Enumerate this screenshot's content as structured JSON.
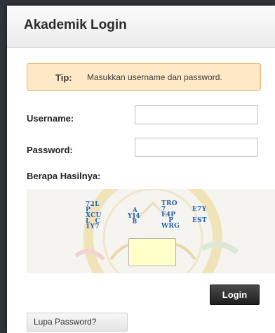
{
  "dialog": {
    "title": "Akademik Login"
  },
  "tip": {
    "label": "Tip:",
    "text": "Masukkan username dan password."
  },
  "form": {
    "username_label": "Username:",
    "username_value": "",
    "password_label": "Password:",
    "password_value": "",
    "captcha_label": "Berapa Hasilnya:",
    "captcha_answer": ""
  },
  "captcha": {
    "columns": [
      "72L\nP\nXCU\nL  C\n1Y7",
      "  A\nYJ4\n  8",
      "TRO\n7\nF4P\n   P\nWRG",
      "E7Y\n\nEST"
    ],
    "text_color": "#1f5fb8"
  },
  "buttons": {
    "login_label": "Login",
    "forgot_label": "Lupa Password?"
  },
  "colors": {
    "tip_background": "#fde9c6",
    "tip_border": "#e8b36a",
    "login_button": "#2a2a2a",
    "captcha_input_background": "#ffffc8"
  }
}
